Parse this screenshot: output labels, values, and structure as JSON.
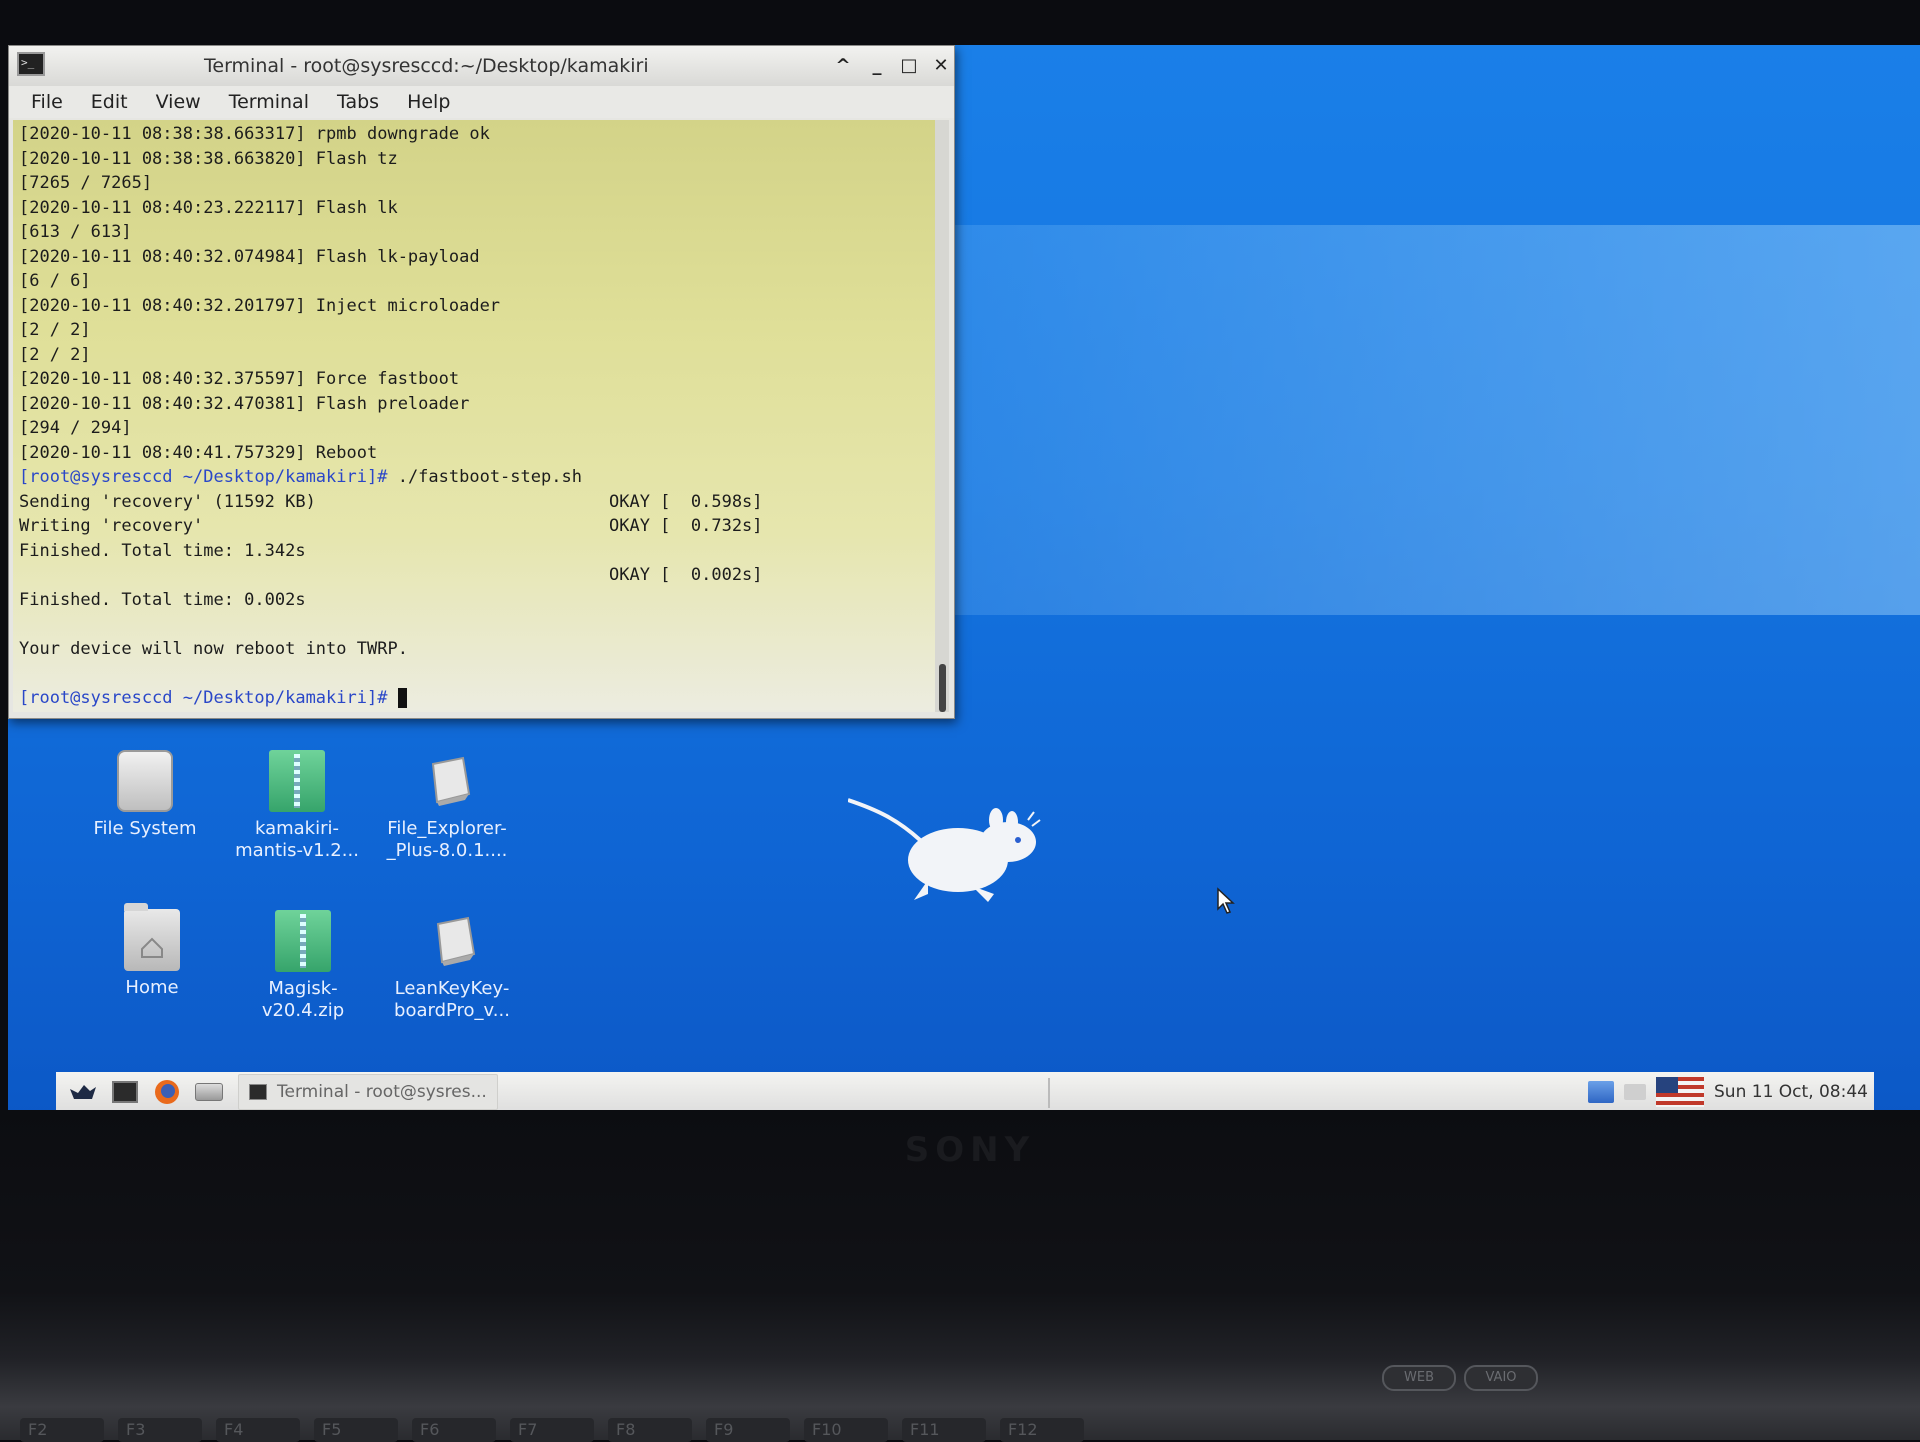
{
  "terminal": {
    "title": "Terminal - root@sysresccd:~/Desktop/kamakiri",
    "menu": [
      "File",
      "Edit",
      "View",
      "Terminal",
      "Tabs",
      "Help"
    ],
    "lines": [
      "[2020-10-11 08:38:38.663317] rpmb downgrade ok",
      "[2020-10-11 08:38:38.663820] Flash tz",
      "[7265 / 7265]",
      "[2020-10-11 08:40:23.222117] Flash lk",
      "[613 / 613]",
      "[2020-10-11 08:40:32.074984] Flash lk-payload",
      "[6 / 6]",
      "[2020-10-11 08:40:32.201797] Inject microloader",
      "[2 / 2]",
      "[2 / 2]",
      "[2020-10-11 08:40:32.375597] Force fastboot",
      "[2020-10-11 08:40:32.470381] Flash preloader",
      "[294 / 294]",
      "[2020-10-11 08:40:41.757329] Reboot"
    ],
    "prompt": "[root@sysresccd ~/Desktop/kamakiri]#",
    "command": " ./fastboot-step.sh",
    "out_sending": "Sending 'recovery' (11592 KB)",
    "out_sending_status": "OKAY [  0.598s]",
    "out_writing": "Writing 'recovery'",
    "out_writing_status": "OKAY [  0.732s]",
    "out_finished1": "Finished. Total time: 1.342s",
    "out_blank_status": "OKAY [  0.002s]",
    "out_finished2": "Finished. Total time: 0.002s",
    "out_reboot_msg": "Your device will now reboot into TWRP.",
    "final_prompt": "[root@sysresccd ~/Desktop/kamakiri]#"
  },
  "desktop_icons": [
    {
      "name": "file-system",
      "line1": "File System",
      "line2": "",
      "icon": "drive-icon"
    },
    {
      "name": "kamakiri-zip",
      "line1": "kamakiri-",
      "line2": "mantis-v1.2...",
      "icon": "zip-icon"
    },
    {
      "name": "file-explorer-apk",
      "line1": "File_Explorer-",
      "line2": "_Plus-8.0.1....",
      "icon": "apk-icon"
    },
    {
      "name": "home",
      "line1": "Home",
      "line2": "",
      "icon": "home-folder-icon"
    },
    {
      "name": "magisk-zip",
      "line1": "Magisk-",
      "line2": "v20.4.zip",
      "icon": "zip-icon"
    },
    {
      "name": "leankey-apk",
      "line1": "LeanKeyKey-",
      "line2": "boardPro_v...",
      "icon": "apk-icon"
    }
  ],
  "taskbar": {
    "task_label": "Terminal - root@sysres...",
    "clock": "Sun 11 Oct, 08:44"
  },
  "hardware": {
    "brand": "SONY",
    "buttons": [
      "WEB",
      "VAIO"
    ],
    "fkeys": [
      "F2",
      "F3",
      "F4",
      "F5",
      "F6",
      "F7",
      "F8",
      "F9",
      "F10",
      "F11",
      "F12"
    ]
  },
  "colors": {
    "desktop_blue": "#1475e0",
    "terminal_bg": "#dfdf98",
    "prompt_blue": "#2a47c8"
  }
}
